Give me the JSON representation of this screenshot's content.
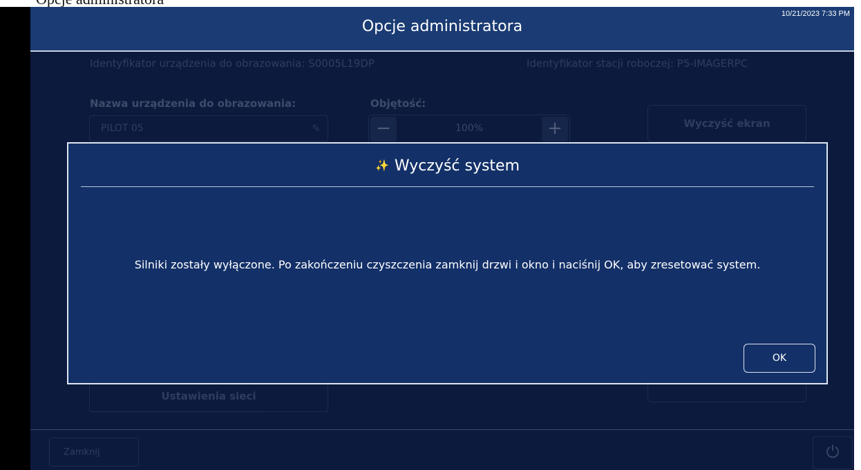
{
  "window_caption": "Opcje administratora",
  "header": {
    "title": "Opcje administratora",
    "clock": "10/21/2023 7:33 PM"
  },
  "background": {
    "device_id": "Identyfikator urządzenia do obrazowania: S0005L19DP",
    "workstation_id": "Identyfikator stacji roboczej: P5-IMAGERPC",
    "name_label": "Nazwa urządzenia do obrazowania:",
    "name_value": "PILOT 05",
    "volume_label": "Objętość:",
    "volume_value": "100%",
    "minus_glyph": "−",
    "plus_glyph": "+",
    "wipe_screen_label": "Wyczyść ekran",
    "network_settings_label": "Ustawienia sieci",
    "close_label": "Zamknij",
    "pencil_glyph": "✎",
    "power_glyph": "⏻"
  },
  "modal": {
    "icon": "sparkle-icon",
    "sparkle_glyph": "✨",
    "title": "Wyczyść system",
    "message": "Silniki zostały wyłączone. Po zakończeniu czyszczenia zamknij drzwi i okno i naciśnij OK, aby zresetować system.",
    "ok_label": "OK"
  },
  "colors": {
    "app_bg": "#0c1a3d",
    "header_bg": "#1a3b73",
    "modal_bg": "#133068",
    "border": "#dfe6f2"
  }
}
